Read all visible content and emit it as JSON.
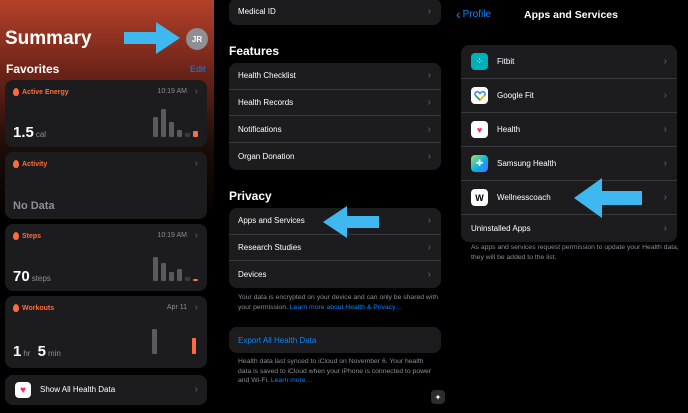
{
  "summary": {
    "title": "Summary",
    "avatar_initials": "JR",
    "favorites_title": "Favorites",
    "edit_label": "Edit",
    "cards": [
      {
        "title": "Active Energy",
        "time": "10:19 AM",
        "value": "1.5",
        "unit": "cal",
        "color": "#ff6b3d"
      },
      {
        "title": "Activity",
        "time": "",
        "value": "No Data",
        "unit": "",
        "color": "#ff6b3d"
      },
      {
        "title": "Steps",
        "time": "10:19 AM",
        "value": "70",
        "unit": "steps",
        "color": "#ff6b3d"
      },
      {
        "title": "Workouts",
        "time": "Apr 11",
        "value_h": "1",
        "unit_h": "hr",
        "value_m": "5",
        "unit_m": "min",
        "color": "#ff6b3d"
      }
    ],
    "show_all_label": "Show All Health Data"
  },
  "settings": {
    "medical_id_label": "Medical ID",
    "features_title": "Features",
    "features": [
      "Health Checklist",
      "Health Records",
      "Notifications",
      "Organ Donation"
    ],
    "privacy_title": "Privacy",
    "privacy": [
      "Apps and Services",
      "Research Studies",
      "Devices"
    ],
    "privacy_note": "Your data is encrypted on your device and can only be shared with your permission.",
    "privacy_link": "Learn more about Health & Privacy…",
    "export_label": "Export All Health Data",
    "sync_note": "Health data last synced to iCloud on November 6. Your health data is saved to iCloud when your iPhone is connected to power and Wi-Fi.",
    "sync_link": "Learn more…"
  },
  "apps_services": {
    "back_label": "Profile",
    "title": "Apps and Services",
    "apps": [
      {
        "name": "Fitbit",
        "icon": "fitbit-icon"
      },
      {
        "name": "Google Fit",
        "icon": "google-fit-icon"
      },
      {
        "name": "Health",
        "icon": "health-icon"
      },
      {
        "name": "Samsung Health",
        "icon": "samsung-health-icon"
      },
      {
        "name": "Wellnesscoach",
        "icon": "wellnesscoach-icon"
      }
    ],
    "uninstalled_label": "Uninstalled Apps",
    "note": "As apps and services request permission to update your Health data, they will be added to the list."
  },
  "colors": {
    "accent": "#0a84ff",
    "arrow": "#3fb8f0",
    "card_bg": "#1c1c1e"
  }
}
